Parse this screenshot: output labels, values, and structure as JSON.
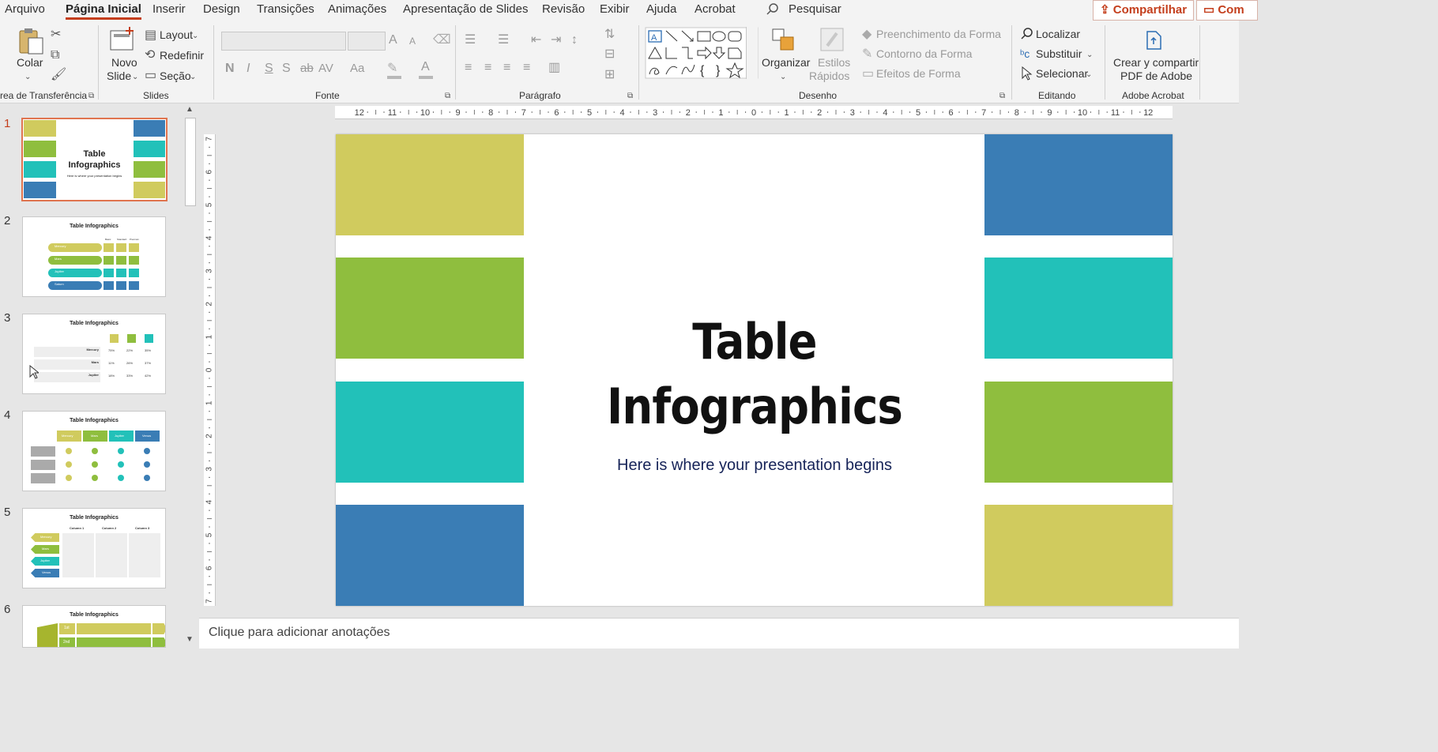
{
  "menu": {
    "items": [
      "Arquivo",
      "Página Inicial",
      "Inserir",
      "Design",
      "Transições",
      "Animações",
      "Apresentação de Slides",
      "Revisão",
      "Exibir",
      "Ajuda",
      "Acrobat"
    ],
    "search_label": "Pesquisar",
    "share_label": "Compartilhar",
    "comments_label": "Com"
  },
  "ribbon": {
    "clipboard": {
      "paste_label": "Colar",
      "group_label": "rea de Transferência"
    },
    "slides": {
      "new_slide_label": "Novo",
      "new_slide_label2": "Slide",
      "layout_label": "Layout",
      "reset_label": "Redefinir",
      "section_label": "Seção",
      "group_label": "Slides"
    },
    "font": {
      "group_label": "Fonte",
      "bold": "N",
      "italic": "I",
      "underline": "S",
      "shadow": "S",
      "strike": "ab",
      "spacing": "AV",
      "case": "Aa",
      "grow": "A",
      "shrink": "A",
      "color": "A"
    },
    "paragraph": {
      "group_label": "Parágrafo"
    },
    "drawing": {
      "arrange_label": "Organizar",
      "styles_label": "Estilos",
      "styles_label2": "Rápidos",
      "fill_label": "Preenchimento da Forma",
      "outline_label": "Contorno da Forma",
      "effects_label": "Efeitos de Forma",
      "group_label": "Desenho"
    },
    "editing": {
      "find_label": "Localizar",
      "replace_label": "Substituir",
      "select_label": "Selecionar",
      "group_label": "Editando"
    },
    "acrobat": {
      "create_label": "Crear y compartir",
      "create_label2": "PDF de Adobe",
      "group_label": "Adobe Acrobat"
    }
  },
  "thumbnails": [
    {
      "num": "1",
      "title": "Table",
      "title2": "Infographics",
      "subtitle": "Here is where your presentation begins"
    },
    {
      "num": "2",
      "title": "Table Infographics",
      "rows": [
        "Mercury",
        "Mars",
        "Jupiter",
        "Saturn"
      ],
      "cols": [
        "Basic",
        "Standard",
        "Premium"
      ]
    },
    {
      "num": "3",
      "title": "Table Infographics",
      "rows": [
        "Mercury",
        "Mars",
        "Jupiter"
      ],
      "values": [
        [
          "75%",
          "22%",
          "35%"
        ],
        [
          "11%",
          "26%",
          "37%"
        ],
        [
          "18%",
          "33%",
          "42%"
        ]
      ]
    },
    {
      "num": "4",
      "title": "Table Infographics",
      "cols": [
        "Mercury",
        "Mars",
        "Jupiter",
        "Venus"
      ]
    },
    {
      "num": "5",
      "title": "Table Infographics",
      "cols": [
        "Column 1",
        "Column 2",
        "Column 3"
      ],
      "rows": [
        "Mercury",
        "Mars",
        "Jupiter",
        "Venus"
      ]
    },
    {
      "num": "6",
      "title": "Table Infographics",
      "rows": [
        "1st",
        "2nd"
      ]
    }
  ],
  "ruler": {
    "h_ticks": [
      "12",
      "11",
      "10",
      "9",
      "8",
      "7",
      "6",
      "5",
      "4",
      "3",
      "2",
      "1",
      "0",
      "1",
      "2",
      "3",
      "4",
      "5",
      "6",
      "7",
      "8",
      "9",
      "10",
      "11",
      "12"
    ],
    "v_ticks": [
      "7",
      "6",
      "5",
      "4",
      "3",
      "2",
      "1",
      "0",
      "1",
      "2",
      "3",
      "4",
      "5",
      "6",
      "7"
    ]
  },
  "slide": {
    "title_line1": "Table",
    "title_line2": "Infographics",
    "subtitle": "Here is where your presentation begins",
    "colors": {
      "olive": "#d0cb5e",
      "green": "#8fbe3e",
      "teal": "#22c1b9",
      "blue": "#3a7db5"
    },
    "left_blocks": [
      "olive",
      "green",
      "teal",
      "blue"
    ],
    "right_blocks": [
      "blue",
      "teal",
      "green",
      "olive"
    ]
  },
  "notes": {
    "placeholder": "Clique para adicionar anotações"
  }
}
